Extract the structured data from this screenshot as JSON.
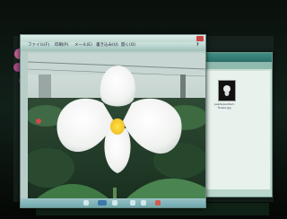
{
  "viewer": {
    "title": "",
    "menu": [
      "ファイル(F)",
      "印刷(P)",
      "メール(E)",
      "書き込み(U)",
      "開く(O)"
    ]
  },
  "explorer": {
    "file_label_1": "paphiopedilum",
    "file_label_2": "flower.jpg"
  },
  "icons": {
    "close": "close-icon",
    "help": "help-icon",
    "prev": "previous-icon",
    "play": "slideshow-icon",
    "next": "next-icon",
    "rotate_left": "rotate-left-icon",
    "rotate_right": "rotate-right-icon",
    "delete": "delete-icon"
  }
}
